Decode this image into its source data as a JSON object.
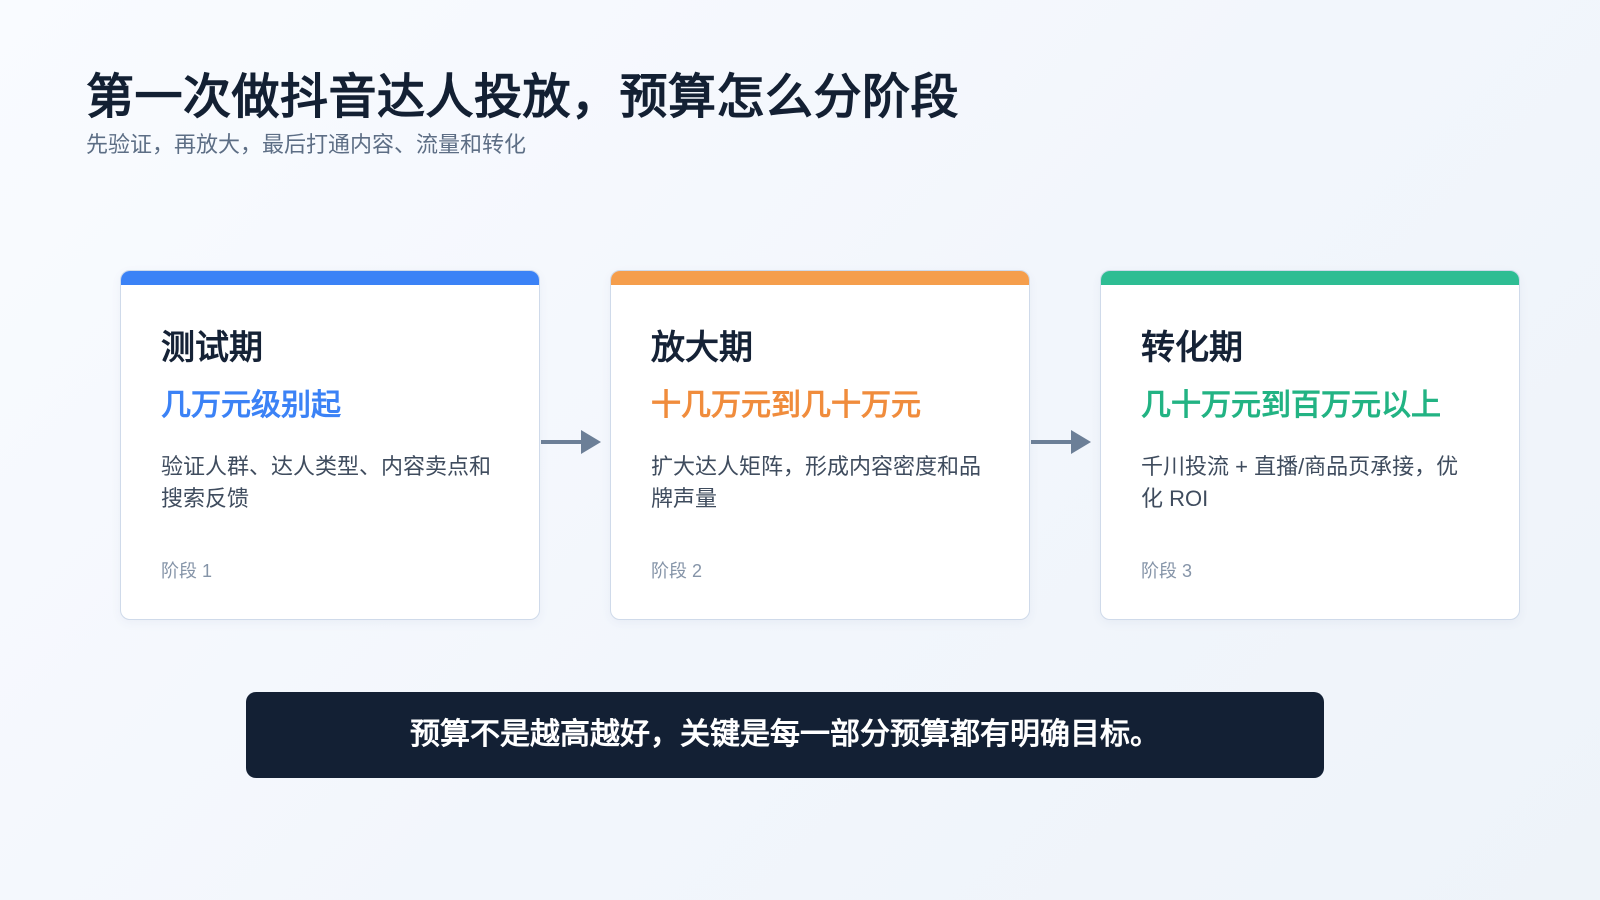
{
  "header": {
    "title": "第一次做抖音达人投放，预算怎么分阶段",
    "subtitle": "先验证，再放大，最后打通内容、流量和转化"
  },
  "stages": [
    {
      "title": "测试期",
      "budget": "几万元级别起",
      "description": "验证人群、达人类型、内容卖点和搜索反馈",
      "stage_label": "阶段 1",
      "accent_color": "#3b82f6"
    },
    {
      "title": "放大期",
      "budget": "十几万元到几十万元",
      "description": "扩大达人矩阵，形成内容密度和品牌声量",
      "stage_label": "阶段 2",
      "accent_color": "#f59e4c"
    },
    {
      "title": "转化期",
      "budget": "几十万元到百万元以上",
      "description": "千川投流 + 直播/商品页承接，优化 ROI",
      "stage_label": "阶段 3",
      "accent_color": "#2ebd93"
    }
  ],
  "connectors": {
    "icon": "arrow-right-icon",
    "color": "#6c7f97"
  },
  "banner": {
    "text": "预算不是越高越好，关键是每一部分预算都有明确目标。",
    "background": "#132034"
  }
}
